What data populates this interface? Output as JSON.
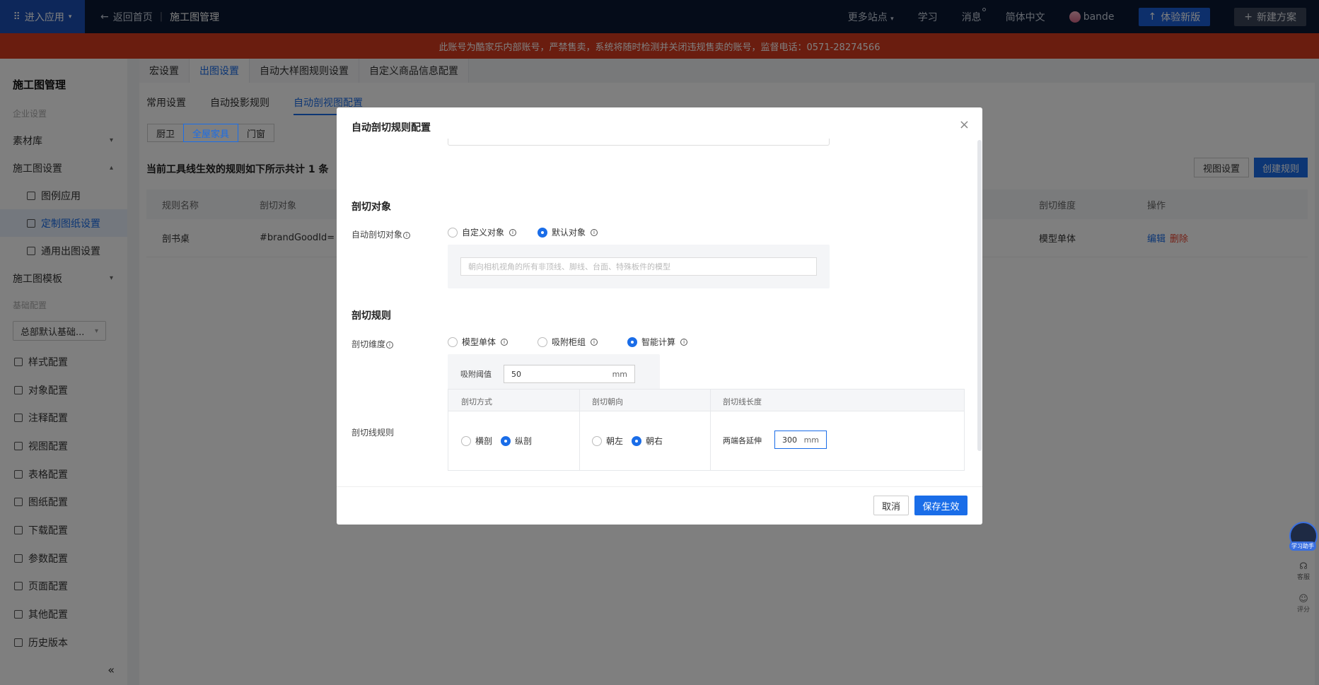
{
  "topbar": {
    "enter_app": "进入应用",
    "back": "返回首页",
    "title": "施工图管理",
    "more_sites": "更多站点",
    "learn": "学习",
    "messages": "消息",
    "language": "简体中文",
    "user": "bande",
    "try_new": "体验新版",
    "new_plan": "新建方案"
  },
  "banner": "此账号为酷家乐内部账号，严禁售卖，系统将随时检测并关闭违规售卖的账号，监督电话：0571-28274566",
  "sidebar": {
    "title": "施工图管理",
    "group_enterprise": "企业设置",
    "material_lib": "素材库",
    "drawing_settings": "施工图设置",
    "sub_items": [
      "图例应用",
      "定制图纸设置",
      "通用出图设置"
    ],
    "template": "施工图模板",
    "group_basic": "基础配置",
    "basic_select": "总部默认基础...",
    "config_items": [
      "样式配置",
      "对象配置",
      "注释配置",
      "视图配置",
      "表格配置",
      "图纸配置",
      "下载配置",
      "参数配置",
      "页面配置",
      "其他配置",
      "历史版本"
    ],
    "collapse": "«"
  },
  "main": {
    "tabs": [
      "宏设置",
      "出图设置",
      "自动大样图规则设置",
      "自定义商品信息配置"
    ],
    "subtabs": [
      "常用设置",
      "自动投影规则",
      "自动剖视图配置"
    ],
    "segments": [
      "厨卫",
      "全屋家具",
      "门窗"
    ],
    "rule_count": "当前工具线生效的规则如下所示共计 1 条",
    "view_settings": "视图设置",
    "create_rule": "创建规则",
    "table_headers": [
      "规则名称",
      "剖切对象",
      "剖切维度",
      "操作"
    ],
    "row": {
      "name": "剖书桌",
      "object": "#brandGoodId=",
      "dimension": "模型单体",
      "edit": "编辑",
      "delete": "删除"
    }
  },
  "float": {
    "robot_tag": "学习助手",
    "service": "客服",
    "feedback": "评分"
  },
  "modal": {
    "title": "自动剖切规则配置",
    "close": "×",
    "section_object": "剖切对象",
    "auto_object_label": "自动剖切对象",
    "object_options": [
      "自定义对象",
      "默认对象"
    ],
    "object_placeholder": "朝向相机视角的所有非顶线、脚线、台面、特殊板件的模型",
    "section_rule": "剖切规则",
    "dimension_label": "剖切维度",
    "dimension_options": [
      "模型单体",
      "吸附柜组",
      "智能计算"
    ],
    "snap_label": "吸附阈值",
    "snap_value": "50",
    "unit": "mm",
    "line_rule_label": "剖切线规则",
    "line_table_headers": [
      "剖切方式",
      "剖切朝向",
      "剖切线长度"
    ],
    "cut_mode_options": [
      "横剖",
      "纵剖"
    ],
    "cut_dir_options": [
      "朝左",
      "朝右"
    ],
    "extend_label": "两端各延伸",
    "extend_value": "300",
    "cancel": "取消",
    "save": "保存生效"
  }
}
